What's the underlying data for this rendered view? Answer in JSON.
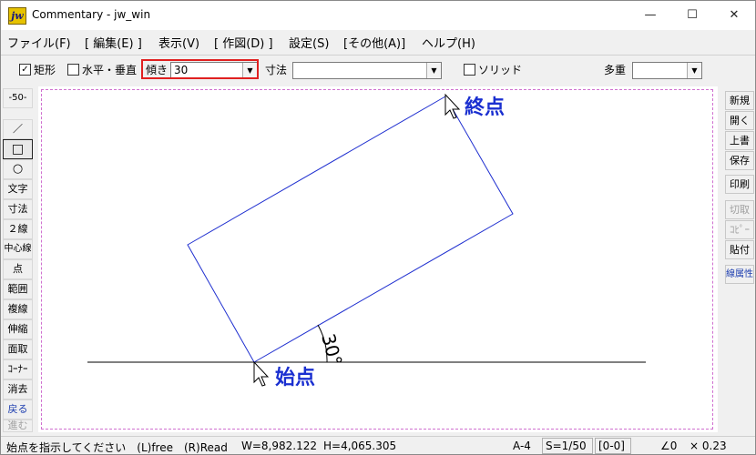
{
  "window": {
    "title": "Commentary - jw_win",
    "app_icon_text": "jw"
  },
  "title_buttons": {
    "minimize": "—",
    "maximize": "☐",
    "close": "✕"
  },
  "menu": [
    "ファイル(F)",
    "[ 編集(E) ]",
    "表示(V)",
    "[ 作図(D) ]",
    "設定(S)",
    "[その他(A)]",
    "ヘルプ(H)"
  ],
  "toolbar": {
    "rect_checkbox": {
      "label": "矩形",
      "checked": true,
      "mark": "✓"
    },
    "hv_checkbox": {
      "label": "水平・垂直",
      "checked": false
    },
    "tilt": {
      "label": "傾き",
      "value": "30"
    },
    "dimension": {
      "label": "寸法",
      "value": ""
    },
    "solid_checkbox": {
      "label": "ソリッド",
      "checked": false
    },
    "multi": {
      "label": "多重",
      "value": ""
    }
  },
  "left_palette": {
    "scale_box": "-50-",
    "tools": [
      "／",
      "□",
      "○",
      "文字",
      "寸法",
      "２線",
      "中心線",
      "点",
      "範囲",
      "複線",
      "伸縮",
      "面取",
      "ｺｰﾅｰ",
      "消去",
      "戻る",
      "進む"
    ]
  },
  "right_palette": [
    "新規",
    "開く",
    "上書",
    "保存",
    "印刷",
    "切取",
    "ｺﾋﾟｰ",
    "貼付",
    "線属性"
  ],
  "canvas": {
    "end_label": "終点",
    "start_label": "始点",
    "angle_label": "30°",
    "annotation_color": "#1a2fd0",
    "rect_color": "#2030d0"
  },
  "status": {
    "message": "始点を指示してください　(L)free　(R)Read",
    "width": "W=8,982.122",
    "height": "H=4,065.305",
    "paper": "A-4",
    "scale": "S=1/50",
    "layer": "[0-0]",
    "angle": "∠0",
    "zoom": "× 0.23"
  }
}
